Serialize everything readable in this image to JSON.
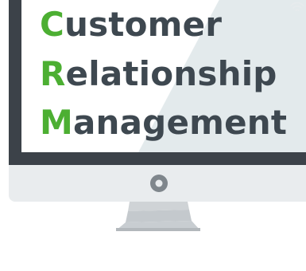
{
  "headline": {
    "lines": [
      {
        "initial": "C",
        "rest": "ustomer"
      },
      {
        "initial": "R",
        "rest": "elationship"
      },
      {
        "initial": "M",
        "rest": "anagement"
      }
    ]
  },
  "colors": {
    "accent": "#4caf32",
    "text": "#3e4850",
    "bezel": "#3c4249",
    "screen_shade": "#e3eaec",
    "chin": "#e9ecee",
    "stand": "#c8cdd1"
  },
  "icons": {
    "wifi": "wifi-icon",
    "power": "power-button-icon"
  }
}
